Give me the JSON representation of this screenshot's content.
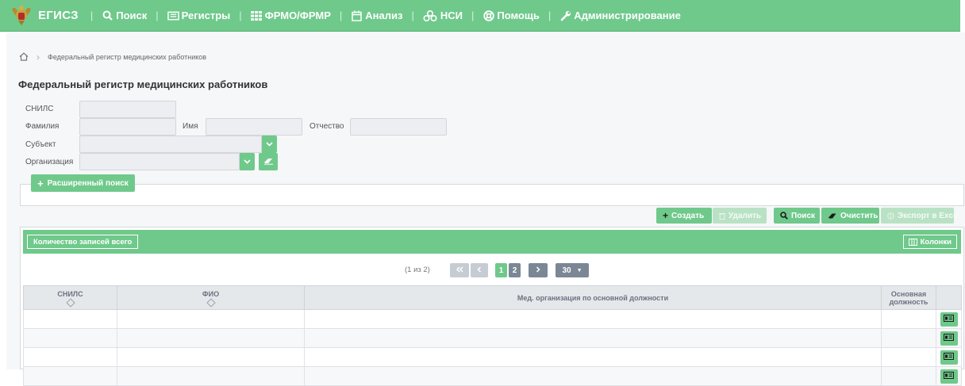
{
  "navbar": {
    "brand": "ЕГИСЗ",
    "items": [
      {
        "label": "Поиск",
        "icon": "search-icon"
      },
      {
        "label": "Регистры",
        "icon": "registry-icon"
      },
      {
        "label": "ФРМО/ФРМР",
        "icon": "grid-icon"
      },
      {
        "label": "Анализ",
        "icon": "calendar-icon"
      },
      {
        "label": "НСИ",
        "icon": "cubes-icon"
      },
      {
        "label": "Помощь",
        "icon": "lifebuoy-icon"
      },
      {
        "label": "Администрирование",
        "icon": "wrench-icon"
      }
    ],
    "separator": "|"
  },
  "breadcrumb": {
    "current": "Федеральный регистр медицинских работников"
  },
  "page_title": "Федеральный регистр медицинских работников",
  "form": {
    "snils_label": "СНИЛС",
    "snils_value": "",
    "lastname_label": "Фамилия",
    "lastname_value": "",
    "firstname_label": "Имя",
    "firstname_value": "",
    "patronymic_label": "Отчество",
    "patronymic_value": "",
    "subject_label": "Субъект",
    "subject_value": "",
    "organization_label": "Организация",
    "organization_value": "",
    "advanced_search_label": "Расширенный поиск"
  },
  "toolbar": {
    "create_label": "Создать",
    "delete_label": "Удалить",
    "search_label": "Поиск",
    "clear_label": "Очистить",
    "export_label": "Экспорт в Excel"
  },
  "grid": {
    "count_label": "Количество записей всего",
    "columns_label": "Колонки",
    "pager": {
      "info": "(1 из 2)",
      "pages": [
        "1",
        "2"
      ],
      "current_page": "1",
      "page_size": "30"
    },
    "headers": {
      "snils": "СНИЛС",
      "fio": "ФИО",
      "org": "Мед. организация по основной должности",
      "position_line1": "Основная",
      "position_line2": "должность"
    },
    "rows": [
      {
        "snils": "",
        "fio": "",
        "org": "",
        "position": ""
      },
      {
        "snils": "",
        "fio": "",
        "org": "",
        "position": ""
      },
      {
        "snils": "",
        "fio": "",
        "org": "",
        "position": ""
      },
      {
        "snils": "",
        "fio": "",
        "org": "",
        "position": ""
      }
    ]
  },
  "colors": {
    "accent": "#6fc98b",
    "accent_disabled": "#b9e2c5",
    "page_bg": "#f6f7f9",
    "header_bg": "#e5e8eb",
    "pager_gray": "#7b8794"
  }
}
